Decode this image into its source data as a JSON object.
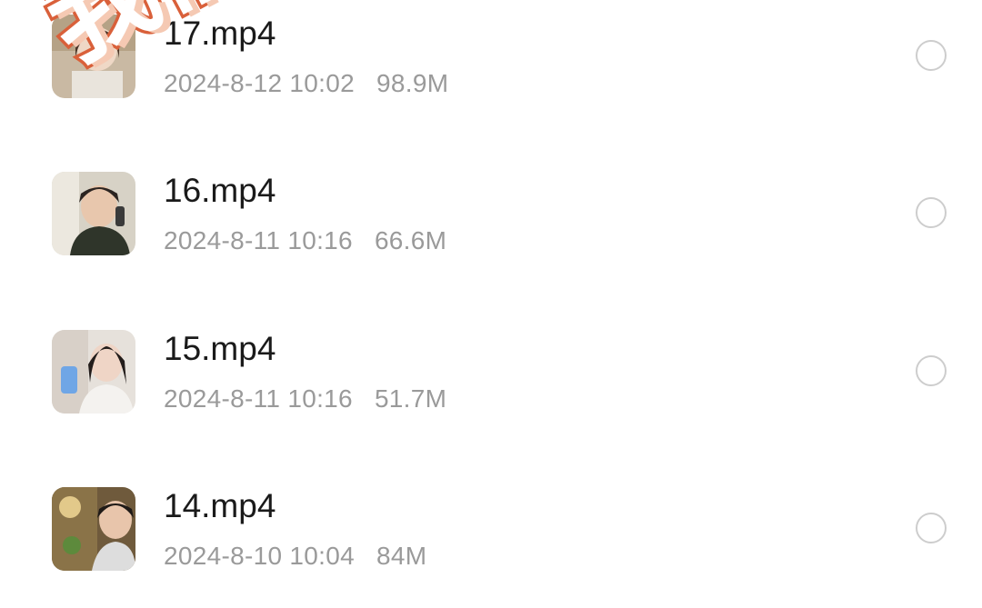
{
  "files": [
    {
      "name": "17.mp4",
      "date": "2024-8-12 10:02",
      "size": "98.9M",
      "thumb_icon": "video-thumbnail"
    },
    {
      "name": "16.mp4",
      "date": "2024-8-11 10:16",
      "size": "66.6M",
      "thumb_icon": "video-thumbnail"
    },
    {
      "name": "15.mp4",
      "date": "2024-8-11 10:16",
      "size": "51.7M",
      "thumb_icon": "video-thumbnail"
    },
    {
      "name": "14.mp4",
      "date": "2024-8-10 10:04",
      "size": "84M",
      "thumb_icon": "video-thumbnail"
    }
  ],
  "watermark": {
    "text": "我们在"
  },
  "colors": {
    "filename": "#1a1a1a",
    "meta": "#9a9a9a",
    "radio_border": "#cdcdcd",
    "watermark_stroke": "#d9603a"
  }
}
